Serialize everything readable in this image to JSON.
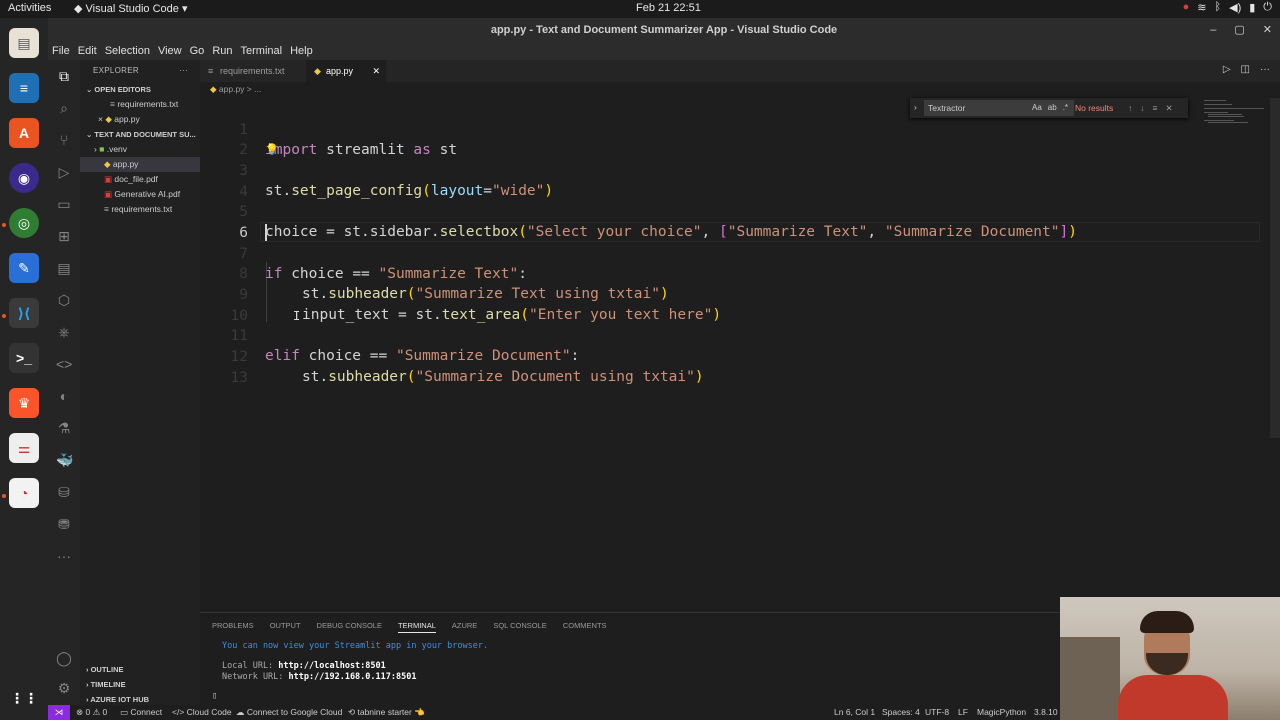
{
  "topbar": {
    "activities": "Activities",
    "app_name": "Visual Studio Code",
    "clock": "Feb 21  22:51"
  },
  "window": {
    "title": "app.py - Text and Document Summarizer App - Visual Studio Code"
  },
  "menu": [
    "File",
    "Edit",
    "Selection",
    "View",
    "Go",
    "Run",
    "Terminal",
    "Help"
  ],
  "explorer": {
    "header": "EXPLORER",
    "open_editors_label": "OPEN EDITORS",
    "open_editors": [
      "requirements.txt",
      "app.py"
    ],
    "project_label": "TEXT AND DOCUMENT SU...",
    "files": [
      ".venv",
      "app.py",
      "doc_file.pdf",
      "Generative AI.pdf",
      "requirements.txt"
    ],
    "outline": "OUTLINE",
    "timeline": "TIMELINE",
    "azure": "AZURE IOT HUB"
  },
  "tabs": [
    "requirements.txt",
    "app.py"
  ],
  "breadcrumb": "app.py > ...",
  "find": {
    "query": "Textractor",
    "result": "No results",
    "options": [
      "Aa",
      "ab",
      ".*"
    ]
  },
  "editor": {
    "line_numbers": [
      "1",
      "2",
      "3",
      "4",
      "5",
      "6",
      "7",
      "8",
      "9",
      "10",
      "11",
      "12",
      "13"
    ],
    "current_line": "6",
    "code": {
      "l1_kw": "import",
      "l1_mod": " streamlit ",
      "l1_as": "as",
      "l1_alias": " st",
      "l3_a": "st.",
      "l3_fn": "set_page_config",
      "l3_arg": "layout",
      "l3_eq": "=",
      "l3_str": "\"wide\"",
      "l5_a": "choice = st.sidebar.",
      "l5_fn": "selectbox",
      "l5_s1": "\"Select your choice\"",
      "l5_comma": ", ",
      "l5_s2": "\"Summarize Text\"",
      "l5_comma2": ", ",
      "l5_s3": "\"Summarize Document\"",
      "l7_kw": "if",
      "l7_a": " choice ",
      "l7_op": "==",
      "l7_str": " \"Summarize Text\"",
      "l7_colon": ":",
      "l8_a": "st.",
      "l8_fn": "subheader",
      "l8_str": "\"Summarize Text using txtai\"",
      "l9_a": "input_text = st.",
      "l9_fn": "text_area",
      "l9_str": "\"Enter you text here\"",
      "l11_kw": "elif",
      "l11_a": " choice ",
      "l11_op": "==",
      "l11_str": " \"Summarize Document\"",
      "l11_colon": ":",
      "l12_a": "st.",
      "l12_fn": "subheader",
      "l12_str": "\"Summarize Document using txtai\""
    }
  },
  "panel": {
    "tabs": [
      "PROBLEMS",
      "OUTPUT",
      "DEBUG CONSOLE",
      "TERMINAL",
      "AZURE",
      "SQL CONSOLE",
      "COMMENTS"
    ],
    "active_tab": "TERMINAL",
    "line1": "You can now view your Streamlit app in your browser.",
    "local_label": "Local URL: ",
    "local_url": "http://localhost:8501",
    "network_label": "Network URL: ",
    "network_url": "http://192.168.0.117:8501"
  },
  "status": {
    "errors": "⊗ 0 ⚠ 0",
    "connect": "Connect",
    "cloud": "Cloud Code",
    "google": "Connect to Google Cloud",
    "tabnine": "tabnine starter",
    "position": "Ln 6, Col 1",
    "spaces": "Spaces: 4",
    "encoding": "UTF-8",
    "eol": "LF",
    "language": "MagicPython",
    "version": "3.8.10"
  },
  "colors": {
    "keyword": "#c586c0",
    "string": "#ce9178",
    "function": "#dcdcaa",
    "remote": "#8a2be2"
  }
}
